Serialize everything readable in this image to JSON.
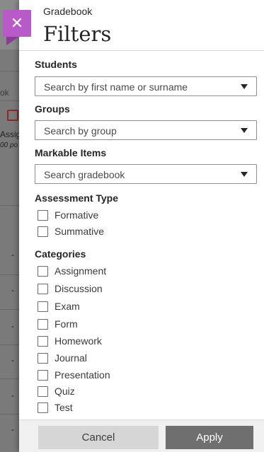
{
  "background": {
    "tab_fragment": "ok",
    "column_fragment": "Assig",
    "points_fragment": "00 po",
    "cell_dash": "-"
  },
  "panel": {
    "breadcrumb": "Gradebook",
    "title": "Filters",
    "close_glyph": "✕",
    "accent_color": "#b85ac7"
  },
  "students": {
    "label": "Students",
    "placeholder": "Search by first name or surname"
  },
  "groups": {
    "label": "Groups",
    "placeholder": "Search by group"
  },
  "markable_items": {
    "label": "Markable Items",
    "placeholder": "Search gradebook"
  },
  "assessment_type": {
    "label": "Assessment Type",
    "options": [
      "Formative",
      "Summative"
    ]
  },
  "categories": {
    "label": "Categories",
    "options": [
      "Assignment",
      "Discussion",
      "Exam",
      "Form",
      "Homework",
      "Journal",
      "Presentation",
      "Quiz",
      "Test"
    ]
  },
  "footer": {
    "cancel_label": "Cancel",
    "apply_label": "Apply"
  }
}
